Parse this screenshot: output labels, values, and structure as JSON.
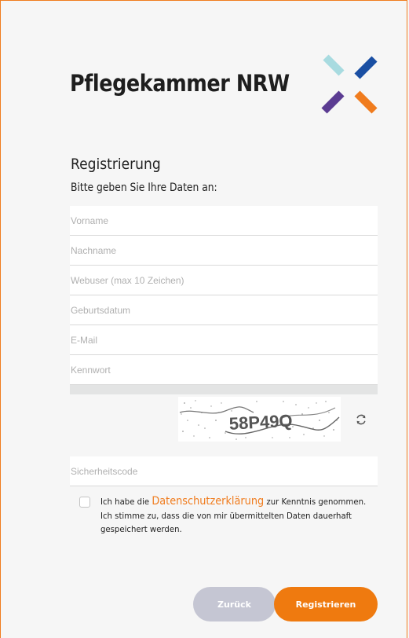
{
  "brand": {
    "name": "Pflegekammer NRW",
    "logo_colors": [
      "#a8dbe0",
      "#1a4fa3",
      "#5b3c92",
      "#f07c1e"
    ]
  },
  "form": {
    "title": "Registrierung",
    "subtitle": "Bitte geben Sie Ihre Daten an:",
    "fields": [
      {
        "placeholder": "Vorname",
        "value": ""
      },
      {
        "placeholder": "Nachname",
        "value": ""
      },
      {
        "placeholder": "Webuser (max 10 Zeichen)",
        "value": ""
      },
      {
        "placeholder": "Geburtsdatum",
        "value": ""
      },
      {
        "placeholder": "E-Mail",
        "value": ""
      },
      {
        "placeholder": "Kennwort",
        "value": ""
      }
    ],
    "captcha": {
      "text": "58P49Q",
      "refresh_icon": "refresh-icon"
    },
    "security_code": {
      "placeholder": "Sicherheitscode",
      "value": ""
    },
    "consent": {
      "checked": false,
      "prefix": "Ich habe die",
      "link_text": "Datenschutzerklärung",
      "suffix": "zur Kenntnis genommen.",
      "line2": "Ich stimme zu, dass die von mir übermittelten Daten dauerhaft",
      "line3": "gespeichert werden."
    },
    "buttons": {
      "back_label": "Zurück",
      "register_label": "Registrieren"
    }
  },
  "colors": {
    "accent": "#ef7a0f",
    "border": "#f07c1e",
    "back_button": "#c5c6d3"
  }
}
